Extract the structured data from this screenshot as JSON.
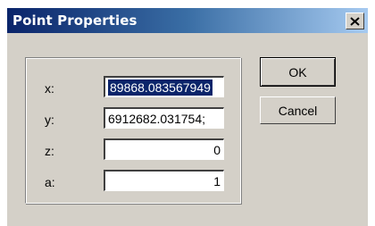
{
  "window": {
    "title": "Point Properties",
    "close_symbol": "close-icon"
  },
  "fields": {
    "x": {
      "label": "x:",
      "value": "89868.083567949"
    },
    "y": {
      "label": "y:",
      "value": "6912682.031754;"
    },
    "z": {
      "label": "z:",
      "value": "0"
    },
    "a": {
      "label": "a:",
      "value": "1"
    }
  },
  "buttons": {
    "ok": "OK",
    "cancel": "Cancel"
  },
  "colors": {
    "dialog_face": "#d4d0c8",
    "title_start": "#0a246a",
    "title_end": "#a6caf0",
    "selection": "#0a246a"
  }
}
